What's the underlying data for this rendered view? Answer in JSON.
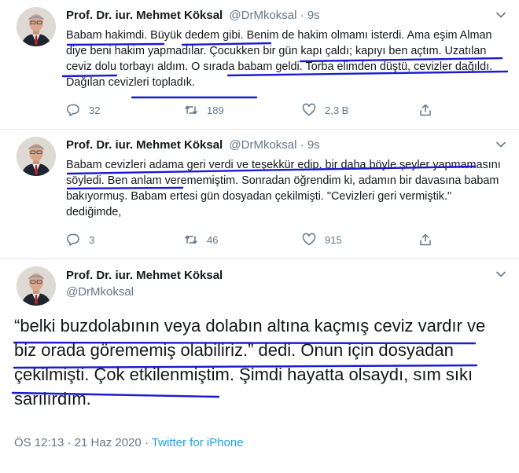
{
  "colors": {
    "ink": "#14171a",
    "muted": "#657786",
    "link": "#1da1f2",
    "underline": "#1a1ad4",
    "border": "#e6ecf0"
  },
  "author": {
    "name": "Prof. Dr. iur. Mehmet Köksal",
    "handle": "@DrMkoksal"
  },
  "tweets": [
    {
      "time": "9s",
      "text": "Babam hakimdi. Büyük dedem gibi. Benim de hakim olmamı isterdi. Ama eşim Alman diye beni hakim yapmadılar. Çocukken bir gün kapı çaldı; kapıyı ben açtım. Uzatılan ceviz dolu torbayı aldım. O sırada babam geldi. Torba elimden düştü, cevizler dağıldı. Dağılan cevizleri topladık.",
      "reply_count": "32",
      "retweet_count": "189",
      "like_count": "2,3 B"
    },
    {
      "time": "9s",
      "text": "Babam cevizleri adama geri verdi ve teşekkür edip, bir daha böyle şeyler yapmamasını söyledi. Ben anlam verememiştim. Sonradan öğrendim ki, adamın bir davasına babam bakıyormuş. Babam ertesi gün dosyadan çekilmişti. \"Cevizleri geri vermiştik.\" dediğimde,",
      "reply_count": "3",
      "retweet_count": "46",
      "like_count": "915"
    }
  ],
  "main_tweet": {
    "text": "“belki buzdolabının veya dolabın altına kaçmış ceviz vardır ve biz orada görememiş olabiliriz.” dedi. Onun için dosyadan çekilmişti. Çok etkilenmiştim. Şimdi hayatta olsaydı, sım sıkı sarılırdım.",
    "timestamp": "ÖS 12:13 · 21 Haz 2020 · ",
    "source": "Twitter for iPhone"
  },
  "icons": {
    "reply": "speech-bubble-icon",
    "retweet": "retweet-arrows-icon",
    "like": "heart-outline-icon",
    "share": "share-upload-icon",
    "more": "chevron-down-icon"
  }
}
